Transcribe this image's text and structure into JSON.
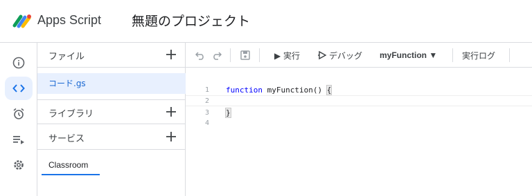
{
  "header": {
    "app_name": "Apps Script",
    "project_title": "無題のプロジェクト"
  },
  "rail": {
    "items": [
      "info-icon",
      "code-icon",
      "alarm-icon",
      "executions-icon",
      "settings-icon"
    ],
    "active": "code-icon"
  },
  "files_panel": {
    "files_label": "ファイル",
    "file_name": "コード.gs",
    "libraries_label": "ライブラリ",
    "services_label": "サービス",
    "service_item": "Classroom"
  },
  "toolbar": {
    "undo_icon": "undo-icon",
    "redo_icon": "redo-icon",
    "save_icon": "save-icon",
    "run_label": "▶ 実行",
    "debug_label": "デバッグ",
    "function_select": "myFunction ▼",
    "log_label": "実行ログ"
  },
  "editor": {
    "lines": [
      {
        "num": "1",
        "keyword": "function",
        "text": " myFunction() ",
        "brace": "{"
      },
      {
        "num": "2",
        "keyword": "",
        "text": "",
        "brace": ""
      },
      {
        "num": "3",
        "keyword": "",
        "text": "",
        "brace": "}"
      },
      {
        "num": "4",
        "keyword": "",
        "text": "",
        "brace": ""
      }
    ]
  },
  "colors": {
    "accent": "#1a73e8",
    "active_bg": "#e8f0fe",
    "divider": "#dadce0"
  }
}
